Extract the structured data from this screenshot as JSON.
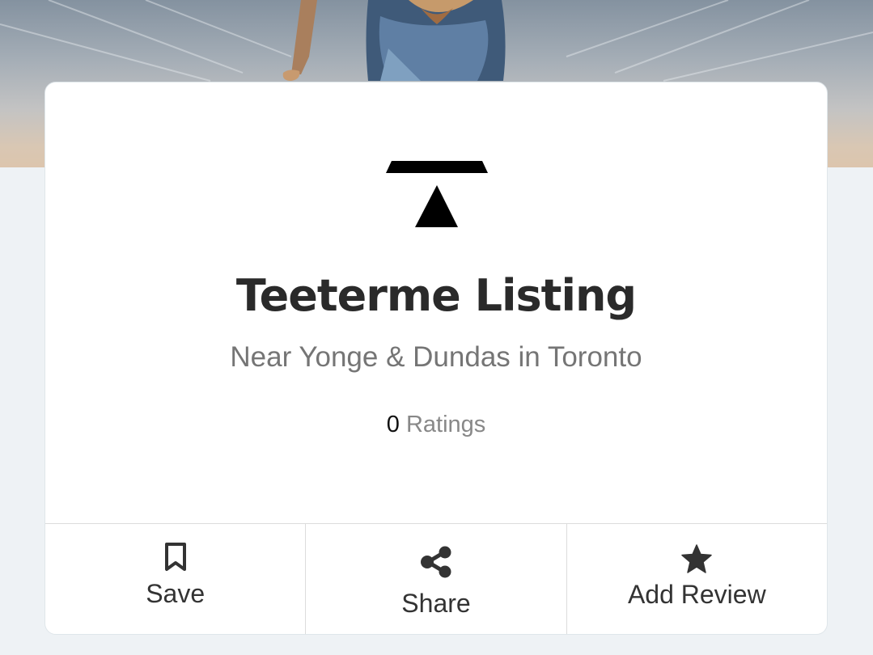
{
  "listing": {
    "title": "Teeterme Listing",
    "location": "Near Yonge & Dundas in Toronto",
    "ratings_count": "0",
    "ratings_label": "Ratings"
  },
  "actions": {
    "save_label": "Save",
    "share_label": "Share",
    "review_label": "Add Review"
  },
  "icons": {
    "logo": "teeterme-logo-icon",
    "save": "bookmark-icon",
    "share": "share-icon",
    "review": "star-icon"
  },
  "colors": {
    "title": "#2a2a2a",
    "subtitle": "#757575",
    "background": "#eef2f5"
  }
}
